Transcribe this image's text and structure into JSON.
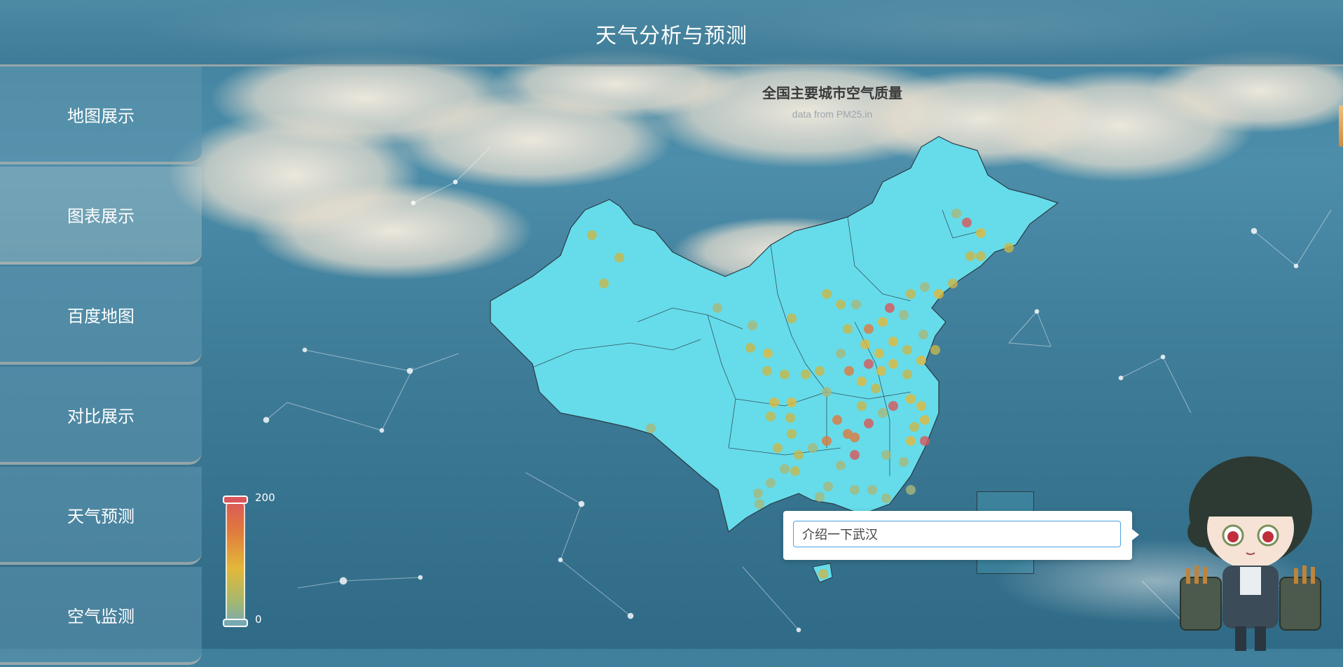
{
  "header": {
    "title": "天气分析与预测"
  },
  "sidebar": {
    "items": [
      {
        "label": "地图展示",
        "active": false
      },
      {
        "label": "图表展示",
        "active": true
      },
      {
        "label": "百度地图",
        "active": false
      },
      {
        "label": "对比展示",
        "active": false
      },
      {
        "label": "天气预测",
        "active": false
      },
      {
        "label": "空气监测",
        "active": false
      }
    ]
  },
  "map": {
    "title": "全国主要城市空气质量",
    "subtitle": "data from PM25.in",
    "legend": {
      "max": "200",
      "min": "0"
    },
    "colors": {
      "land": "#66dcea",
      "border": "#2a3b44",
      "low": "#77aab0",
      "mid": "#e3b83a",
      "high": "#d9575b"
    }
  },
  "chat": {
    "value": "介绍一下武汉",
    "placeholder": ""
  },
  "assistant": {
    "icon": "mascot-character"
  }
}
